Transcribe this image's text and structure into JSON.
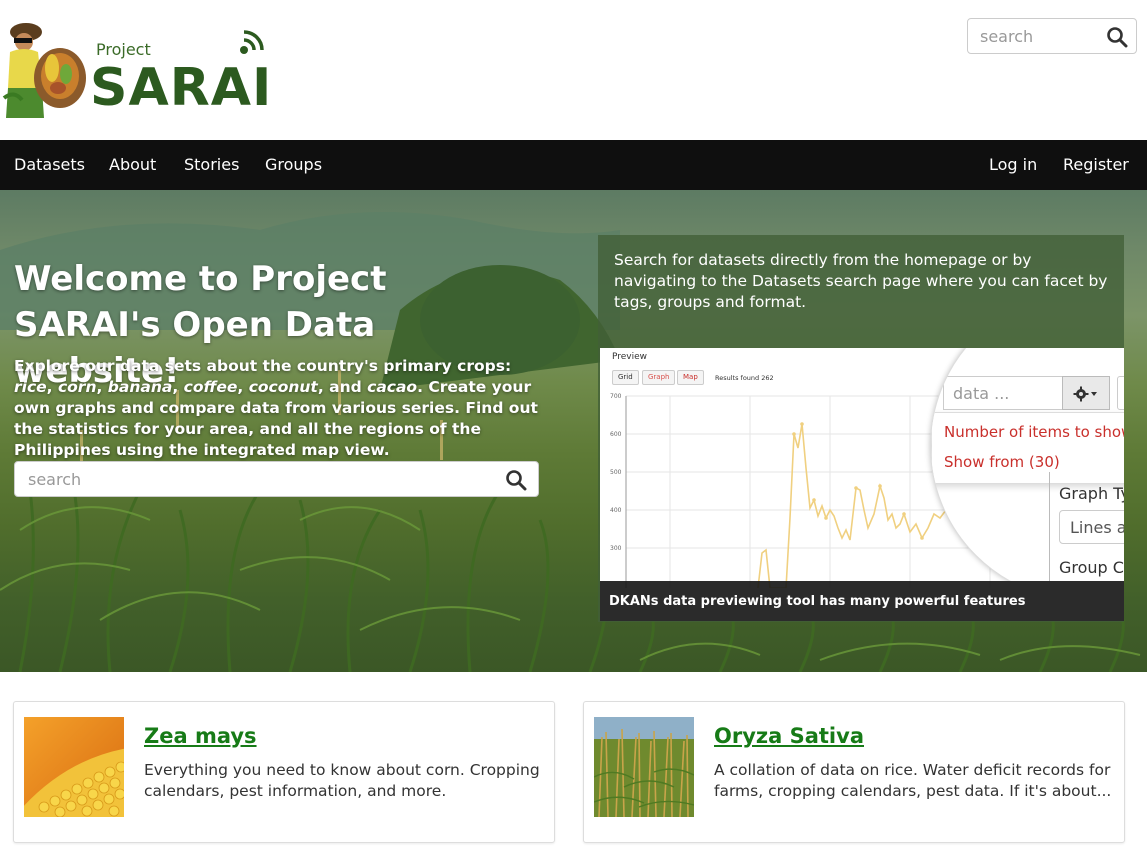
{
  "header": {
    "logo_small": "Project",
    "logo_big": "SARAI",
    "search_placeholder": "search",
    "search_icon": "search-icon"
  },
  "nav": {
    "left": [
      "Datasets",
      "About",
      "Stories",
      "Groups"
    ],
    "right": [
      "Log in",
      "Register"
    ]
  },
  "hero": {
    "title": "Welcome to Project SARAI's Open Data website!",
    "intro_parts": [
      "Explore our data sets about the country's primary crops: ",
      "rice",
      ", ",
      "corn",
      ", ",
      "banana",
      ", ",
      "coffee",
      ", ",
      "coconut",
      ", and ",
      "cacao",
      ". Create your own graphs and compare data from various series. Find out the statistics for your area, and all the regions of the Philippines using the integrated map view."
    ],
    "search_placeholder": "search",
    "search_icon": "search-icon"
  },
  "info_panel": {
    "text": "Search for datasets directly from the homepage or by navigating to the Datasets search page where you can facet by tags, groups and format.",
    "preview": {
      "title": "Preview",
      "buttons": [
        "Grid",
        "Graph",
        "Map"
      ],
      "results": "Results found 262",
      "y_ticks": [
        "700",
        "600",
        "500",
        "400",
        "300"
      ],
      "caption": "DKANs data previewing tool has many powerful features"
    },
    "magnifier": {
      "data_placeholder": "data ...",
      "gear_icon": "gear-icon",
      "menu_items": [
        "Number of items to show",
        "Show from (30)"
      ],
      "graph_type_label": "Graph Ty",
      "lines_value": "Lines a",
      "group_label": "Group Co"
    }
  },
  "cards": [
    {
      "title": "Zea mays",
      "description": "Everything you need to know about corn. Cropping calendars, pest information, and more.",
      "image": "corn-photo"
    },
    {
      "title": "Oryza Sativa",
      "description": "A collation of data on rice. Water deficit records for farms, cropping calendars, pest data. If it's about...",
      "image": "rice-field-photo"
    }
  ],
  "colors": {
    "nav_bg": "#0f0f0f",
    "brand_green": "#2c5a1f",
    "card_title": "#177b17",
    "menu_red": "#c9302c",
    "chart_line": "#f0d080"
  }
}
